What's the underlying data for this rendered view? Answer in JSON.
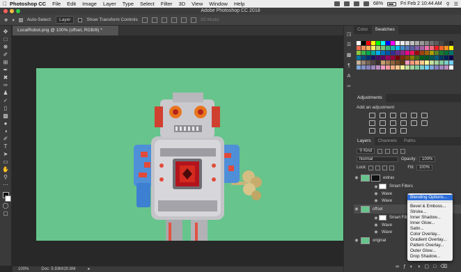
{
  "menubar": {
    "app_name": "Photoshop CC",
    "items": [
      "File",
      "Edit",
      "Image",
      "Layer",
      "Type",
      "Select",
      "Filter",
      "3D",
      "View",
      "Window",
      "Help"
    ],
    "battery": "68%",
    "datetime": "Fri Feb 2  10:44 AM"
  },
  "window": {
    "title": "Adobe Photoshop CC 2018"
  },
  "options": {
    "auto_select_label": "Auto-Select:",
    "auto_select_value": "Layer",
    "transform_label": "Show Transform Controls",
    "mode_3d": "3D Mode:"
  },
  "document": {
    "tab_label": "LocalRobot.png @ 100% (offset, RGB/8) *",
    "canvas_color": "#66c48c"
  },
  "status": {
    "zoom": "100%",
    "doc_size": "Doc: 5.93M/20.8M"
  },
  "panels": {
    "color_tabs": [
      "Color",
      "Swatches"
    ],
    "adjustments_tab": "Adjustments",
    "adjustments_label": "Add an adjustment",
    "layers_tabs": [
      "Layers",
      "Channels",
      "Paths"
    ],
    "filter_kind": "Kind",
    "blend_mode": "Normal",
    "opacity_label": "Opacity:",
    "opacity_value": "100%",
    "lock_label": "Lock:",
    "fill_label": "Fill:",
    "fill_value": "100%"
  },
  "layers": [
    {
      "name": "extras",
      "type": "layer"
    },
    {
      "name": "Smart Filters",
      "type": "filters"
    },
    {
      "name": "Wave",
      "type": "filter"
    },
    {
      "name": "Wave",
      "type": "filter"
    },
    {
      "name": "offset",
      "type": "layer"
    },
    {
      "name": "Smart Filters",
      "type": "filters"
    },
    {
      "name": "Wave",
      "type": "filter"
    },
    {
      "name": "Wave",
      "type": "filter"
    },
    {
      "name": "original",
      "type": "layer"
    }
  ],
  "context_menu": [
    "Blending Options...",
    "Bevel & Emboss...",
    "Stroke...",
    "Inner Shadow...",
    "Inner Glow...",
    "Satin...",
    "Color Overlay...",
    "Gradient Overlay...",
    "Pattern Overlay...",
    "Outer Glow...",
    "Drop Shadow..."
  ],
  "tools": [
    "move-tool",
    "marquee-tool",
    "lasso-tool",
    "quick-select-tool",
    "crop-tool",
    "eyedropper-tool",
    "healing-tool",
    "brush-tool",
    "clone-stamp-tool",
    "history-brush-tool",
    "eraser-tool",
    "gradient-tool",
    "blur-tool",
    "dodge-tool",
    "pen-tool",
    "type-tool",
    "path-select-tool",
    "shape-tool",
    "hand-tool",
    "zoom-tool",
    "more-tools"
  ],
  "swatch_colors": [
    [
      "#ffffff",
      "#000000",
      "#ff0000",
      "#ffff00",
      "#00ff00",
      "#00ffff",
      "#0000ff",
      "#ff00ff",
      "#ffffff",
      "#ebebeb",
      "#d6d6d6",
      "#c2c2c2",
      "#adadad",
      "#999999",
      "#858585",
      "#707070",
      "#5c5c5c",
      "#474747",
      "#333333",
      "#1f1f1f"
    ],
    [
      "#f26c4f",
      "#f68e55",
      "#fbaf5c",
      "#fff467",
      "#acd372",
      "#7cc576",
      "#3bb878",
      "#1abbb4",
      "#00bff3",
      "#438ccb",
      "#5574b9",
      "#605ca8",
      "#855fa8",
      "#a763a8",
      "#f06ea9",
      "#f26d7d",
      "#ed1c24",
      "#f26522",
      "#f7941d",
      "#fff200"
    ],
    [
      "#8dc73f",
      "#39b54a",
      "#00a651",
      "#00a99d",
      "#00aeef",
      "#0072bc",
      "#0054a6",
      "#2e3192",
      "#662d91",
      "#92278f",
      "#ec008c",
      "#ed145b",
      "#9e0b0f",
      "#a0410d",
      "#a36209",
      "#aba000",
      "#598527",
      "#1a7b30",
      "#007236",
      "#00746b"
    ],
    [
      "#0076a3",
      "#004b80",
      "#003471",
      "#1b1464",
      "#440e62",
      "#630460",
      "#9e005d",
      "#9e0039",
      "#790000",
      "#7b2e00",
      "#7d4900",
      "#827b00",
      "#406618",
      "#005e20",
      "#005826",
      "#005952",
      "#005b7f",
      "#003663",
      "#002157",
      "#0d004c"
    ],
    [
      "#c7b299",
      "#998675",
      "#736357",
      "#534741",
      "#37302d",
      "#c69c6d",
      "#a67c52",
      "#8c6239",
      "#754c24",
      "#603913",
      "#f49ac2",
      "#f7977a",
      "#fbad82",
      "#fdc68c",
      "#fff79a",
      "#c4df9b",
      "#a2d39c",
      "#82ca9d",
      "#7bcdc8",
      "#6ecff6"
    ],
    [
      "#7ea7d8",
      "#8493ca",
      "#8882be",
      "#a187be",
      "#bc8dbf",
      "#f49ac1",
      "#f5989d",
      "#f9ad81",
      "#fdc689",
      "#fff799",
      "#c4df9b",
      "#a3d39c",
      "#82ca9c",
      "#7accc8",
      "#6dcff6",
      "#7da7d9",
      "#8781bd",
      "#a186be",
      "#bd8cbf",
      "#ffffff"
    ]
  ]
}
